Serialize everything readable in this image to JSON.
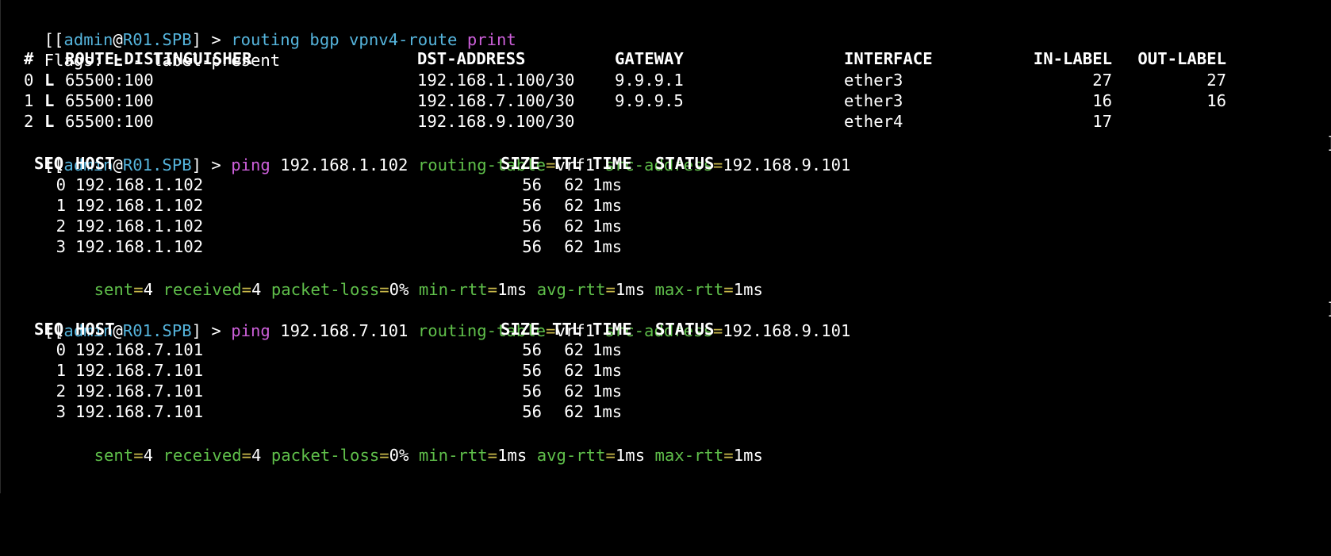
{
  "colors": {
    "background": "#000000",
    "text": "#ffffff",
    "identity": "#55b4dc",
    "command": "#cc5fd9",
    "argument_name": "#5fbf4a",
    "argument_sep": "#c9b94a"
  },
  "prompt": {
    "open": "[[",
    "user": "admin",
    "at": "@",
    "host": "R01.SPB",
    "close_arrow": "] > ",
    "end_bracket": "]"
  },
  "cmd1": {
    "text": "routing bgp vpnv4-route",
    "print": "print"
  },
  "flags_line": {
    "label": "Flags: ",
    "flag": "L",
    "desc": " - label-present"
  },
  "route_table": {
    "headers": {
      "num": "#",
      "rd": "ROUTE-DISTINGUISHER",
      "dst": "DST-ADDRESS",
      "gw": "GATEWAY",
      "iface": "INTERFACE",
      "in_label": "IN-LABEL",
      "out_label": "OUT-LABEL"
    },
    "rows": [
      {
        "num": "0",
        "flag": "L",
        "rd": "65500:100",
        "dst": "192.168.1.100/30",
        "gw": "9.9.9.1",
        "iface": "ether3",
        "in_label": "27",
        "out_label": "27"
      },
      {
        "num": "1",
        "flag": "L",
        "rd": "65500:100",
        "dst": "192.168.7.100/30",
        "gw": "9.9.9.5",
        "iface": "ether3",
        "in_label": "16",
        "out_label": "16"
      },
      {
        "num": "2",
        "flag": "L",
        "rd": "65500:100",
        "dst": "192.168.9.100/30",
        "gw": "",
        "iface": "ether4",
        "in_label": "17",
        "out_label": ""
      }
    ]
  },
  "ping_header": {
    "seq": "SEQ",
    "host": "HOST",
    "size": "SIZE",
    "ttl": "TTL",
    "time": "TIME",
    "status": "STATUS"
  },
  "ping1": {
    "cmd": "ping",
    "target": "192.168.1.102",
    "rt_key": "routing-table",
    "eq": "=",
    "rt_val": "vrf1",
    "src_key": "src-address",
    "src_val": "192.168.9.101",
    "rows": [
      {
        "seq": "0",
        "host": "192.168.1.102",
        "size": "56",
        "ttl": "62",
        "time": "1ms"
      },
      {
        "seq": "1",
        "host": "192.168.1.102",
        "size": "56",
        "ttl": "62",
        "time": "1ms"
      },
      {
        "seq": "2",
        "host": "192.168.1.102",
        "size": "56",
        "ttl": "62",
        "time": "1ms"
      },
      {
        "seq": "3",
        "host": "192.168.1.102",
        "size": "56",
        "ttl": "62",
        "time": "1ms"
      }
    ],
    "summary": {
      "sent_k": "sent",
      "sent_v": "4",
      "recv_k": "received",
      "recv_v": "4",
      "loss_k": "packet-loss",
      "loss_v": "0%",
      "min_k": "min-rtt",
      "min_v": "1ms",
      "avg_k": "avg-rtt",
      "avg_v": "1ms",
      "max_k": "max-rtt",
      "max_v": "1ms"
    }
  },
  "ping2": {
    "cmd": "ping",
    "target": "192.168.7.101",
    "rt_key": "routing-table",
    "eq": "=",
    "rt_val": "vrf1",
    "src_key": "src-address",
    "src_val": "192.168.9.101",
    "rows": [
      {
        "seq": "0",
        "host": "192.168.7.101",
        "size": "56",
        "ttl": "62",
        "time": "1ms"
      },
      {
        "seq": "1",
        "host": "192.168.7.101",
        "size": "56",
        "ttl": "62",
        "time": "1ms"
      },
      {
        "seq": "2",
        "host": "192.168.7.101",
        "size": "56",
        "ttl": "62",
        "time": "1ms"
      },
      {
        "seq": "3",
        "host": "192.168.7.101",
        "size": "56",
        "ttl": "62",
        "time": "1ms"
      }
    ],
    "summary": {
      "sent_k": "sent",
      "sent_v": "4",
      "recv_k": "received",
      "recv_v": "4",
      "loss_k": "packet-loss",
      "loss_v": "0%",
      "min_k": "min-rtt",
      "min_v": "1ms",
      "avg_k": "avg-rtt",
      "avg_v": "1ms",
      "max_k": "max-rtt",
      "max_v": "1ms"
    }
  }
}
